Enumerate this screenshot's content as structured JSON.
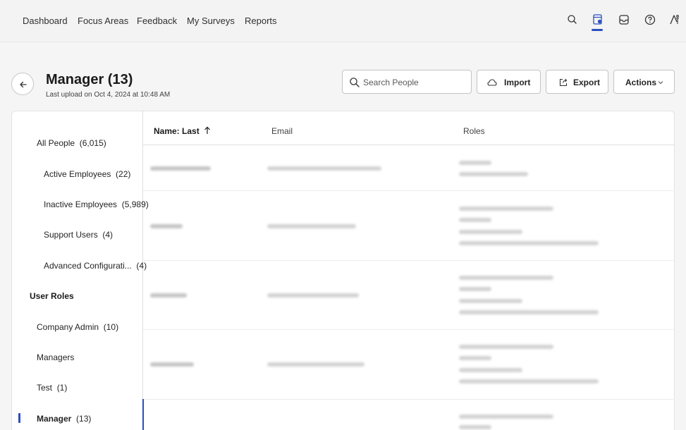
{
  "nav": {
    "items": [
      "Dashboard",
      "Focus Areas",
      "Feedback",
      "My Surveys",
      "Reports"
    ],
    "icons": [
      "search-icon",
      "survey-preview-icon",
      "inbox-icon",
      "help-icon",
      "accessibility-icon"
    ],
    "accent_color": "#2b4fbf"
  },
  "header": {
    "title": "Manager (13)",
    "subtitle": "Last upload on Oct 4, 2024 at 10:48 AM",
    "search_placeholder": "Search People",
    "import_label": "Import",
    "export_label": "Export",
    "actions_label": "Actions"
  },
  "sidebar": {
    "items": [
      {
        "label": "All People",
        "count": "(6,015)"
      },
      {
        "label": "Active Employees",
        "count": "(22)"
      },
      {
        "label": "Inactive Employees",
        "count": "(5,989)"
      },
      {
        "label": "Support Users",
        "count": "(4)"
      },
      {
        "label": "Advanced Configurati...",
        "count": "(4)"
      }
    ],
    "section_title": "User Roles",
    "roles": [
      {
        "label": "Company Admin",
        "count": "(10)"
      },
      {
        "label": "Managers",
        "count": ""
      },
      {
        "label": "Test",
        "count": "(1)"
      },
      {
        "label": "Manager",
        "count": "(13)"
      }
    ],
    "selected": "Manager"
  },
  "table": {
    "columns": [
      "Name: Last",
      "Email",
      "Roles"
    ],
    "sort_column": "Name: Last",
    "sort_direction": "ascending"
  }
}
